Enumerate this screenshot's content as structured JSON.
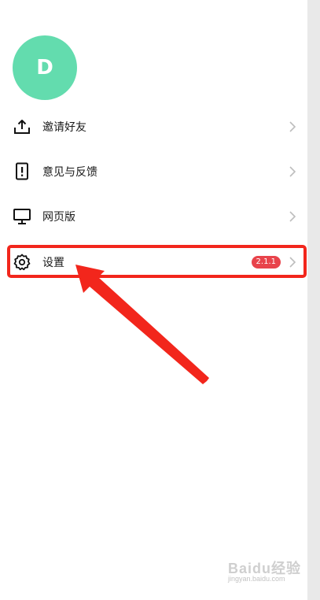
{
  "profile": {
    "avatar_letter": "D",
    "avatar_color": "#63dcae"
  },
  "menu": {
    "items": [
      {
        "label": "邀请好友",
        "icon": "upload-icon"
      },
      {
        "label": "意见与反馈",
        "icon": "feedback-icon"
      },
      {
        "label": "网页版",
        "icon": "monitor-icon"
      },
      {
        "label": "设置",
        "icon": "gear-icon",
        "badge": "2.1.1"
      }
    ]
  },
  "annotation": {
    "highlight_color": "#f2261c",
    "arrow_color": "#f2261c"
  },
  "watermark": {
    "brand": "Baidu经验",
    "url": "jingyan.baidu.com"
  }
}
